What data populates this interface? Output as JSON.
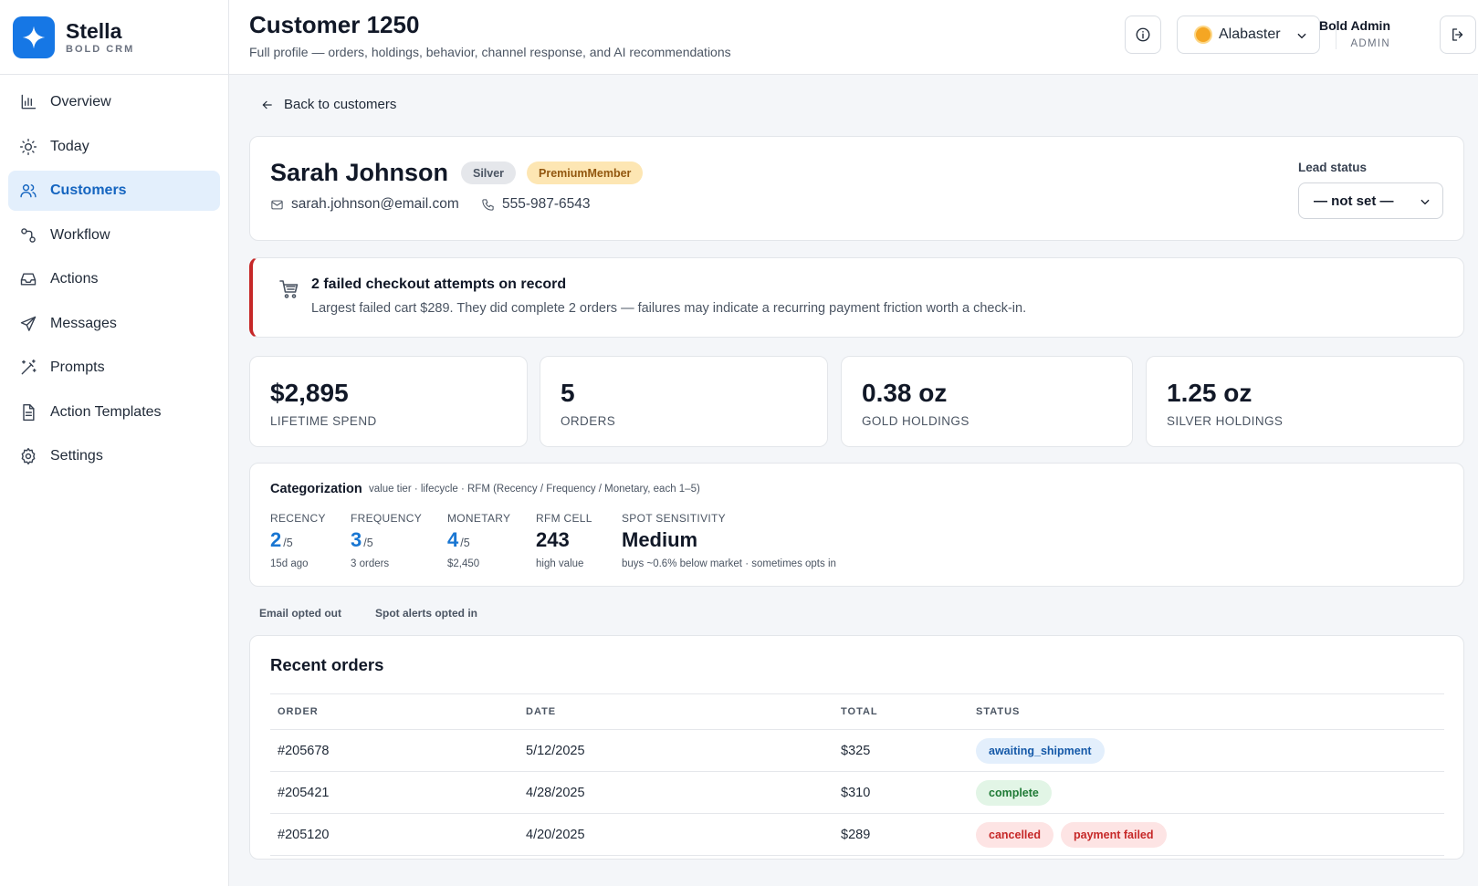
{
  "brand": {
    "name": "Stella",
    "sub": "BOLD CRM"
  },
  "nav": [
    {
      "label": "Overview",
      "icon": "bar-chart-icon",
      "active": false
    },
    {
      "label": "Today",
      "icon": "sun-icon",
      "active": false
    },
    {
      "label": "Customers",
      "icon": "users-icon",
      "active": true
    },
    {
      "label": "Workflow",
      "icon": "workflow-icon",
      "active": false
    },
    {
      "label": "Actions",
      "icon": "inbox-icon",
      "active": false
    },
    {
      "label": "Messages",
      "icon": "send-icon",
      "active": false
    },
    {
      "label": "Prompts",
      "icon": "wand-icon",
      "active": false
    },
    {
      "label": "Action Templates",
      "icon": "document-icon",
      "active": false
    },
    {
      "label": "Settings",
      "icon": "gear-icon",
      "active": false
    }
  ],
  "header": {
    "title": "Customer 1250",
    "subtitle": "Full profile — orders, holdings, behavior, channel response, and AI recommendations",
    "theme": "Alabaster",
    "user_name": "Bold Admin",
    "user_role": "ADMIN"
  },
  "back_label": "Back to customers",
  "customer": {
    "name": "Sarah Johnson",
    "tier_badge": "Silver",
    "member_badge": "PremiumMember",
    "email": "sarah.johnson@email.com",
    "phone": "555-987-6543",
    "lead_status_label": "Lead status",
    "lead_status_value": "— not set —"
  },
  "alert": {
    "title": "2 failed checkout attempts on record",
    "text": "Largest failed cart $289. They did complete 2 orders — failures may indicate a recurring payment friction worth a check-in.",
    "color": "#c62828"
  },
  "stats": [
    {
      "value": "$2,895",
      "label": "LIFETIME SPEND"
    },
    {
      "value": "5",
      "label": "ORDERS"
    },
    {
      "value": "0.38 oz",
      "label": "GOLD HOLDINGS"
    },
    {
      "value": "1.25 oz",
      "label": "SILVER HOLDINGS"
    }
  ],
  "categorization": {
    "title": "Categorization",
    "hint": "value tier · lifecycle · RFM (Recency / Frequency / Monetary, each 1–5)",
    "recency": {
      "label": "RECENCY",
      "value": "2",
      "denom": "/5",
      "sub": "15d ago"
    },
    "frequency": {
      "label": "FREQUENCY",
      "value": "3",
      "denom": "/5",
      "sub": "3 orders"
    },
    "monetary": {
      "label": "MONETARY",
      "value": "4",
      "denom": "/5",
      "sub": "$2,450"
    },
    "rfm_cell": {
      "label": "RFM CELL",
      "value": "243",
      "sub": "high value"
    },
    "spot": {
      "label": "SPOT SENSITIVITY",
      "value": "Medium",
      "sub": "buys ~0.6% below market · sometimes opts in"
    }
  },
  "preferences": {
    "email": "Email opted out",
    "spot": "Spot alerts opted in"
  },
  "orders": {
    "title": "Recent orders",
    "columns": [
      "ORDER",
      "DATE",
      "TOTAL",
      "STATUS"
    ],
    "rows": [
      {
        "order": "#205678",
        "date": "5/12/2025",
        "total": "$325",
        "statuses": [
          "awaiting_shipment"
        ]
      },
      {
        "order": "#205421",
        "date": "4/28/2025",
        "total": "$310",
        "statuses": [
          "complete"
        ]
      },
      {
        "order": "#205120",
        "date": "4/20/2025",
        "total": "$289",
        "statuses": [
          "cancelled",
          "payment failed"
        ]
      }
    ]
  },
  "colors": {
    "accent": "#1677e5",
    "active_nav_bg": "#e3effc",
    "danger": "#c62828",
    "success": "#1f7a35"
  }
}
